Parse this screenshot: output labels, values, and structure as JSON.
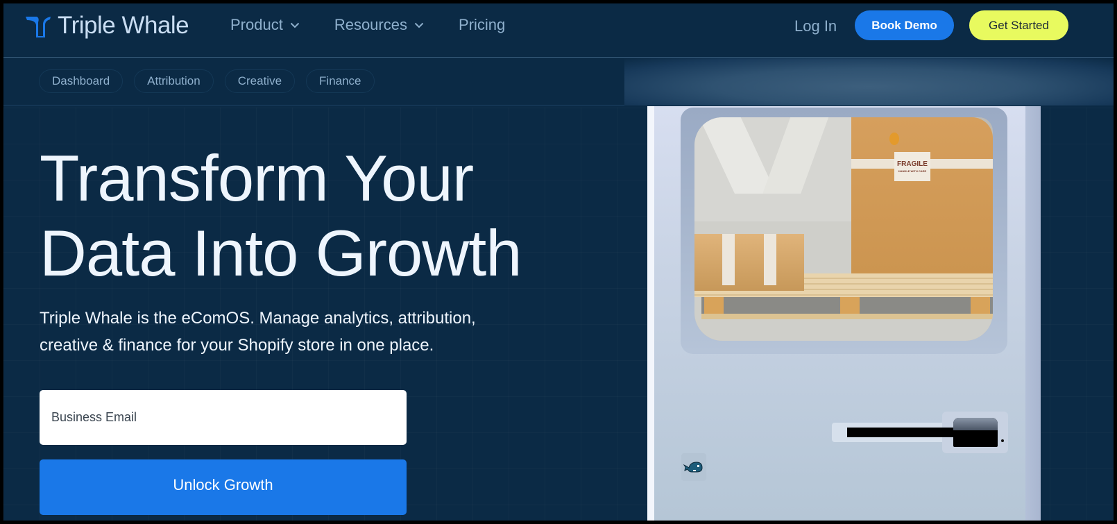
{
  "nav": {
    "brand": "Triple Whale",
    "links": [
      {
        "label": "Product",
        "has_dropdown": true
      },
      {
        "label": "Resources",
        "has_dropdown": true
      },
      {
        "label": "Pricing",
        "has_dropdown": false
      }
    ],
    "login_label": "Log In",
    "book_demo_label": "Book Demo",
    "get_started_label": "Get Started"
  },
  "subnav": {
    "pills": [
      "Dashboard",
      "Attribution",
      "Creative",
      "Finance"
    ]
  },
  "hero": {
    "headline_line1": "Transform Your",
    "headline_line2": "Data Into Growth",
    "subtext_line1": "Triple Whale is the eComOS. Manage analytics, attribution,",
    "subtext_line2": "creative & finance for your Shopify store in one place.",
    "email_placeholder": "Business Email",
    "email_value": "",
    "cta_label": "Unlock Growth"
  },
  "illustration": {
    "label_text": "FRAGILE",
    "label_subtext": "HANDLE WITH CARE",
    "badge_icon": "whale-icon"
  },
  "colors": {
    "background": "#0b2a45",
    "primary_blue": "#1a78e8",
    "accent_yellow": "#e8fa5f",
    "nav_text": "#8fb0cd",
    "headline_text": "#eef5fd"
  }
}
